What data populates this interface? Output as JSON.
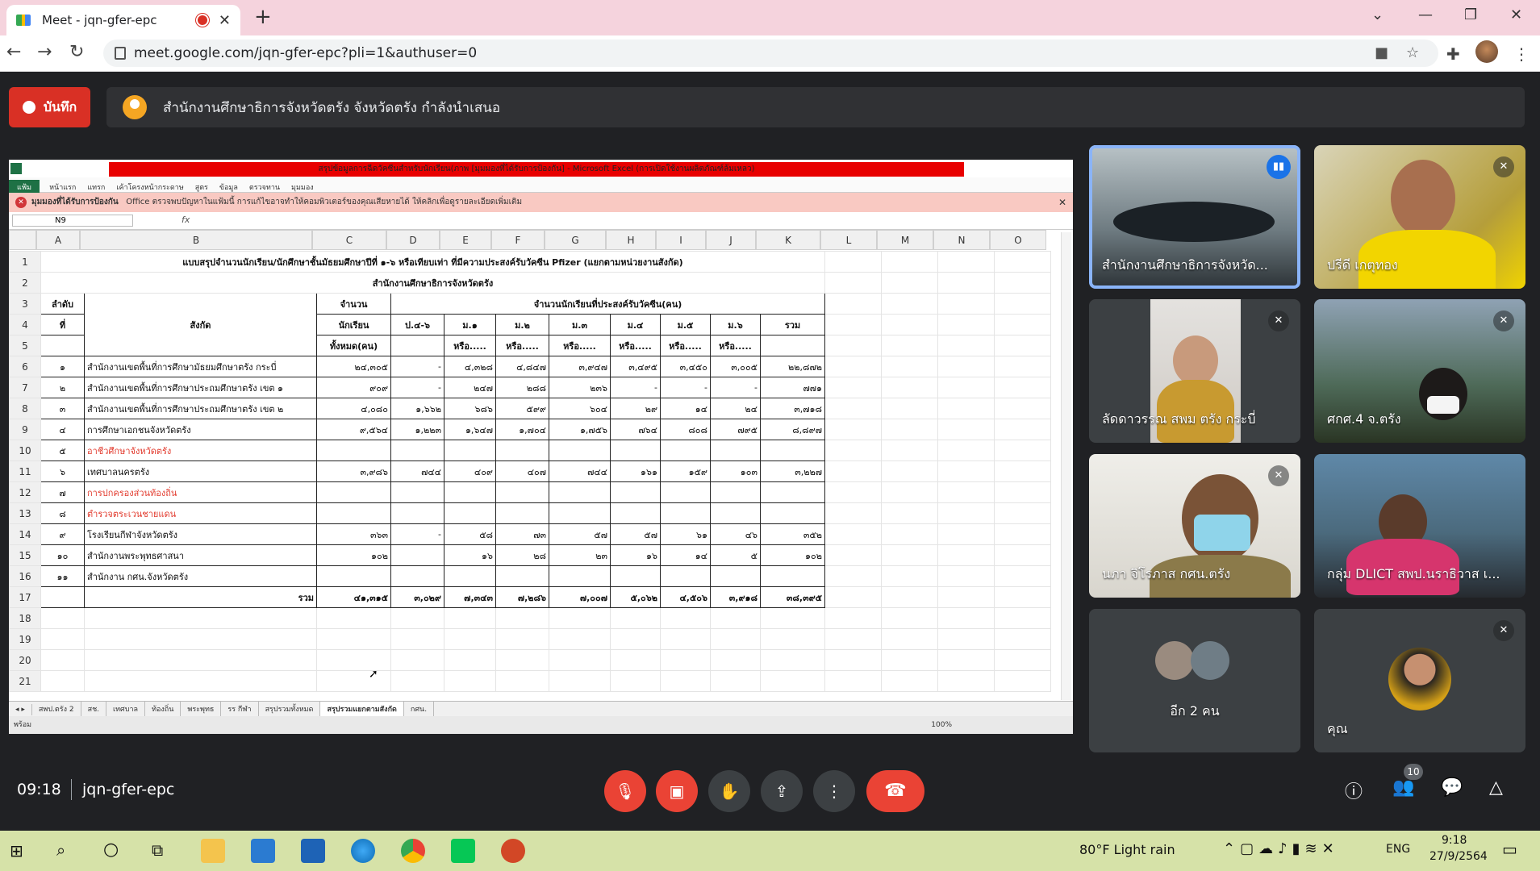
{
  "browser": {
    "tab_title": "Meet - jqn-gfer-epc",
    "url": "meet.google.com/jqn-gfer-epc?pli=1&authuser=0"
  },
  "meet": {
    "record_label": "บันทึก",
    "presenting_text": "สำนักงานศึกษาธิการจังหวัดตรัง จังหวัดตรัง กำลังนำเสนอ",
    "time": "09:18",
    "meeting_code": "jqn-gfer-epc",
    "participants_count": "10"
  },
  "excel": {
    "title_bar": "สรุปข้อมูลการฉีดวัคซีนสำหรับนักเรียน(ภาพ [มุมมองที่ได้รับการป้องกัน] - Microsoft Excel (การเปิดใช้งานผลิตภัณฑ์ล้มเหลว)",
    "ribbon_tabs": [
      "แฟ้ม",
      "หน้าแรก",
      "แทรก",
      "เค้าโครงหน้ากระดาษ",
      "สูตร",
      "ข้อมูล",
      "ตรวจทาน",
      "มุมมอง"
    ],
    "warning_title": "มุมมองที่ได้รับการป้องกัน",
    "warning_text": "Office ตรวจพบปัญหาในแฟ้มนี้ การแก้ไขอาจทำให้คอมพิวเตอร์ของคุณเสียหายได้ ให้คลิกเพื่อดูรายละเอียดเพิ่มเติม",
    "name_box": "N9",
    "fx": "fx",
    "columns": [
      "A",
      "B",
      "C",
      "D",
      "E",
      "F",
      "G",
      "H",
      "I",
      "J",
      "K",
      "L",
      "M",
      "N",
      "O"
    ],
    "row_numbers": [
      "1",
      "2",
      "3",
      "4",
      "5",
      "6",
      "7",
      "8",
      "9",
      "10",
      "11",
      "12",
      "13",
      "14",
      "15",
      "16",
      "17",
      "18",
      "19",
      "20",
      "21"
    ],
    "heading1": "แบบสรุปจำนวนนักเรียน/นักศึกษาชั้นมัธยมศึกษาปีที่ ๑-๖ หรือเทียบเท่า ที่มีความประสงค์รับวัคซีน Pfizer (แยกตามหน่วยงานสังกัด)",
    "heading2": "สำนักงานศึกษาธิการจังหวัดตรัง",
    "hdr_no": "ลำดับ",
    "hdr_no2": "ที่",
    "hdr_org": "สังกัด",
    "hdr_students1": "จำนวน",
    "hdr_students2": "นักเรียน",
    "hdr_students3": "ทั้งหมด(คน)",
    "hdr_group": "จำนวนนักเรียนที่ประสงค์รับวัคซีน(คน)",
    "grades": [
      "ป.๔-๖",
      "ม.๑",
      "ม.๒",
      "ม.๓",
      "ม.๔",
      "ม.๕",
      "ม.๖",
      "รวม"
    ],
    "grades_sub": [
      "",
      "หรือ.....",
      "หรือ.....",
      "หรือ.....",
      "หรือ.....",
      "หรือ.....",
      "หรือ.....",
      ""
    ],
    "rows": [
      {
        "no": "๑",
        "org": "สำนักงานเขตพื้นที่การศึกษามัธยมศึกษาตรัง กระบี่",
        "total": "๒๔,๓๐๕",
        "v": [
          "-",
          "๔,๓๒๘",
          "๔,๘๔๗",
          "๓,๙๔๗",
          "๓,๔๙๕",
          "๓,๔๕๐",
          "๓,๐๐๕",
          "๒๒,๘๗๒"
        ],
        "red": false
      },
      {
        "no": "๒",
        "org": "สำนักงานเขตพื้นที่การศึกษาประถมศึกษาตรัง เขต ๑",
        "total": "๙๐๙",
        "v": [
          "-",
          "๒๔๗",
          "๒๘๘",
          "๒๓๖",
          "-",
          "-",
          "-",
          "๗๗๑"
        ],
        "red": false
      },
      {
        "no": "๓",
        "org": "สำนักงานเขตพื้นที่การศึกษาประถมศึกษาตรัง เขต ๒",
        "total": "๔,๐๘๐",
        "v": [
          "๑,๖๖๒",
          "๖๘๖",
          "๕๙๙",
          "๖๐๔",
          "๒๙",
          "๑๔",
          "๒๔",
          "๓,๗๑๘"
        ],
        "red": false
      },
      {
        "no": "๔",
        "org": "การศึกษาเอกชนจังหวัดตรัง",
        "total": "๙,๕๖๔",
        "v": [
          "๑,๒๒๓",
          "๑,๖๔๗",
          "๑,๗๐๔",
          "๑,๗๕๖",
          "๗๖๔",
          "๘๐๘",
          "๗๙๕",
          "๘,๘๙๗"
        ],
        "red": false
      },
      {
        "no": "๕",
        "org": "อาชีวศึกษาจังหวัดตรัง",
        "total": "",
        "v": [
          "",
          "",
          "",
          "",
          "",
          "",
          "",
          ""
        ],
        "red": true
      },
      {
        "no": "๖",
        "org": "เทศบาลนครตรัง",
        "total": "๓,๙๘๖",
        "v": [
          "๗๔๔",
          "๔๐๙",
          "๔๐๗",
          "๗๔๔",
          "๑๖๑",
          "๑๕๙",
          "๑๐๓",
          "๓,๒๒๗"
        ],
        "red": false
      },
      {
        "no": "๗",
        "org": "การปกครองส่วนท้องถิ่น",
        "total": "",
        "v": [
          "",
          "",
          "",
          "",
          "",
          "",
          "",
          ""
        ],
        "red": true
      },
      {
        "no": "๘",
        "org": "ตำรวจตระเวนชายแดน",
        "total": "",
        "v": [
          "",
          "",
          "",
          "",
          "",
          "",
          "",
          ""
        ],
        "red": true
      },
      {
        "no": "๙",
        "org": "โรงเรียนกีฬาจังหวัดตรัง",
        "total": "๓๖๓",
        "v": [
          "-",
          "๕๘",
          "๗๓",
          "๕๗",
          "๕๗",
          "๖๑",
          "๔๖",
          "๓๕๒"
        ],
        "red": false
      },
      {
        "no": "๑๐",
        "org": "สำนักงานพระพุทธศาสนา",
        "total": "๑๐๒",
        "v": [
          "",
          "๑๖",
          "๒๘",
          "๒๓",
          "๑๖",
          "๑๔",
          "๕",
          "๑๐๒"
        ],
        "red": false
      },
      {
        "no": "๑๑",
        "org": "สำนักงาน กศน.จังหวัดตรัง",
        "total": "",
        "v": [
          "",
          "",
          "",
          "",
          "",
          "",
          "",
          ""
        ],
        "red": false
      }
    ],
    "total_label": "รวม",
    "totals": {
      "total": "๔๑,๓๑๕",
      "v": [
        "๓,๐๒๙",
        "๗,๓๔๓",
        "๗,๒๘๖",
        "๗,๐๐๗",
        "๕,๐๖๒",
        "๔,๕๐๖",
        "๓,๙๑๘",
        "๓๘,๓๙๕"
      ]
    },
    "sheet_tabs": [
      "สพป.ตรัง 2",
      "สช.",
      "เทศบาล",
      "ท้องถิ่น",
      "พระพุทธ",
      "รร กีฬา",
      "สรุปรวมทั้งหมด",
      "สรุปรวมแยกตามสังกัด",
      "กศน."
    ],
    "status": "พร้อม",
    "zoom": "100%"
  },
  "participants": [
    {
      "name": "สำนักงานศึกษาธิการจังหวัด...",
      "speaking": true
    },
    {
      "name": "ปรีดี เกตุทอง",
      "muted": true
    },
    {
      "name": "ลัดดาวรรณ สพม ตรัง กระบี่",
      "muted": true
    },
    {
      "name": "ศกศ.4 จ.ตรัง",
      "muted": true
    },
    {
      "name": "นภา จิโรภาส กศน.ตรัง",
      "muted": true
    },
    {
      "name": "กลุ่ม DLICT สพป.นราธิวาส เ...",
      "muted": false
    },
    {
      "name": "อีก 2 คน"
    },
    {
      "name": "คุณ",
      "muted": true
    }
  ],
  "taskbar": {
    "weather": "80°F  Light rain",
    "lang": "ENG",
    "time": "9:18",
    "date": "27/9/2564"
  }
}
